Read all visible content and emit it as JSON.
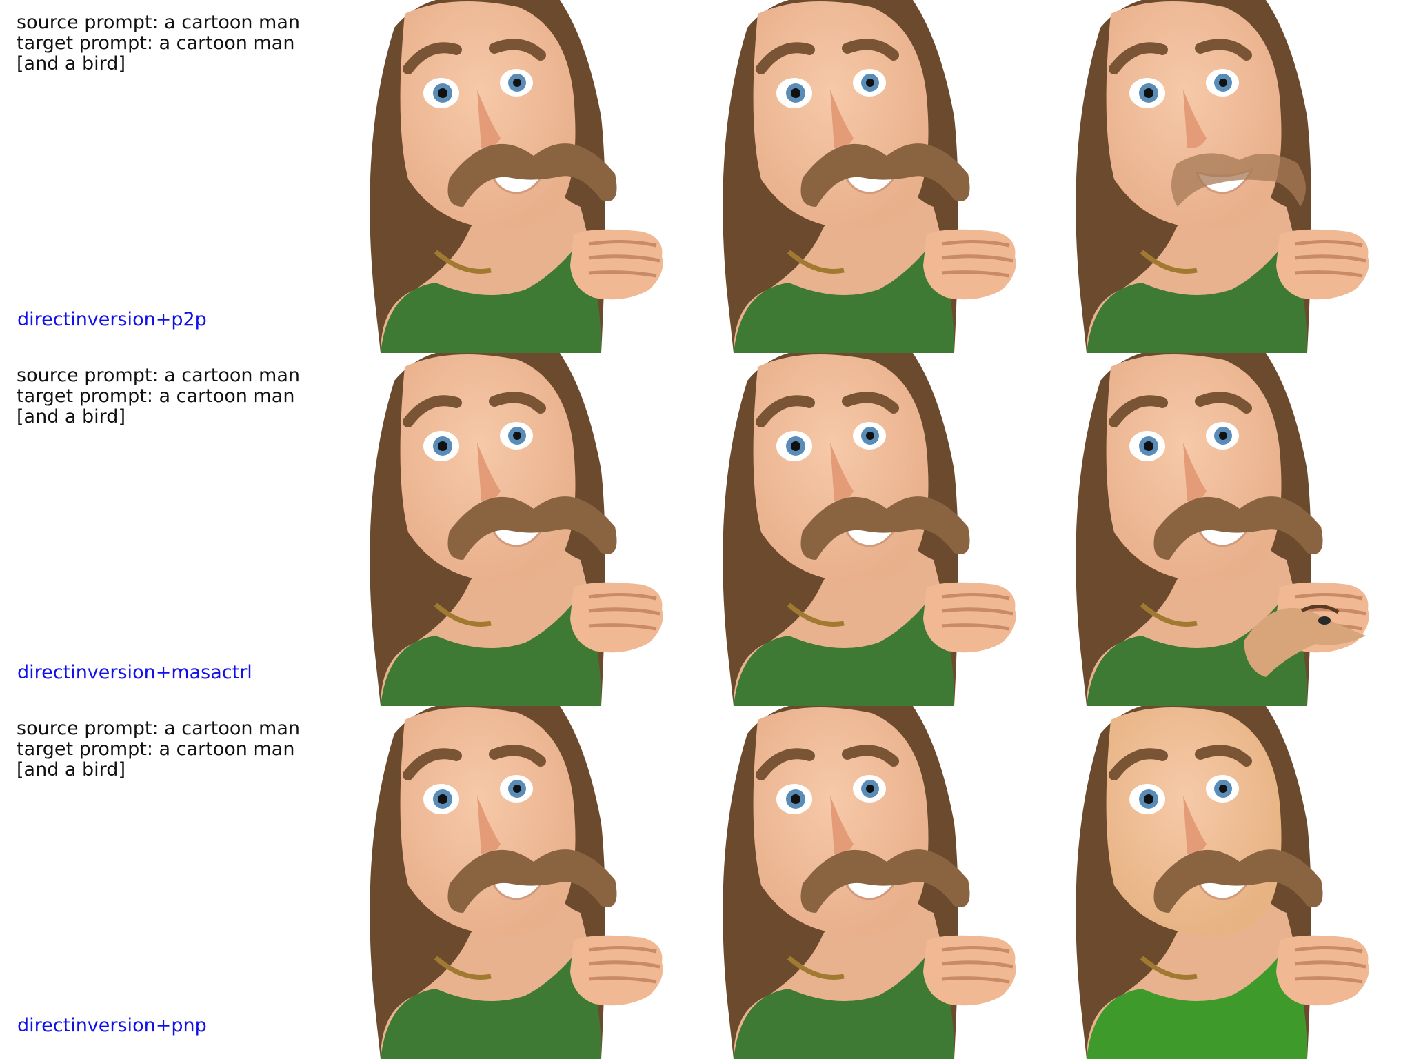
{
  "rows": [
    {
      "source_prompt": "source prompt: a cartoon man",
      "target_prompt": "target prompt: a cartoon man [and a bird]",
      "method": "directinversion+p2p",
      "edited_variant": "p2p"
    },
    {
      "source_prompt": "source prompt: a cartoon man",
      "target_prompt": "target prompt: a cartoon man [and a bird]",
      "method": "directinversion+masactrl",
      "edited_variant": "masactrl"
    },
    {
      "source_prompt": "source prompt: a cartoon man",
      "target_prompt": "target prompt: a cartoon man [and a bird]",
      "method": "directinversion+pnp",
      "edited_variant": "pnp"
    }
  ],
  "colors": {
    "method_label": "#1010e8",
    "caption_text": "#111111",
    "shirt": "#3f7a35",
    "skin": "#e9b08c",
    "hair": "#6b4a2e",
    "mustache": "#8a6440"
  }
}
